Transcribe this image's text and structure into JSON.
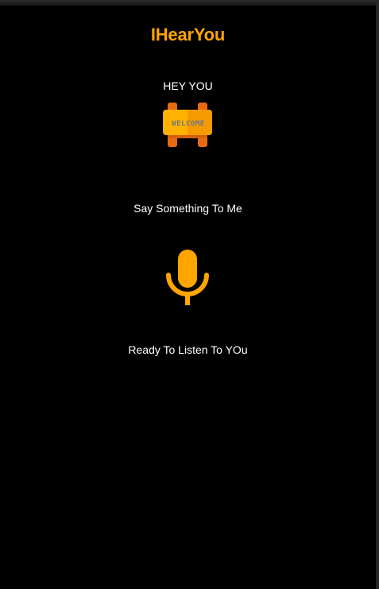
{
  "app": {
    "title": "IHearYou"
  },
  "main": {
    "greeting": "HEY YOU",
    "welcome_sign_text": "WELCOME",
    "prompt": "Say Something To Me",
    "status": "Ready To Listen To YOu"
  },
  "icons": {
    "welcome": "welcome-sign-icon",
    "mic": "microphone-icon"
  },
  "colors": {
    "background": "#000000",
    "accent": "#FFA500",
    "text": "#FFFFFF",
    "sign_post": "#E86A10",
    "sign_board": "#FFB300"
  }
}
